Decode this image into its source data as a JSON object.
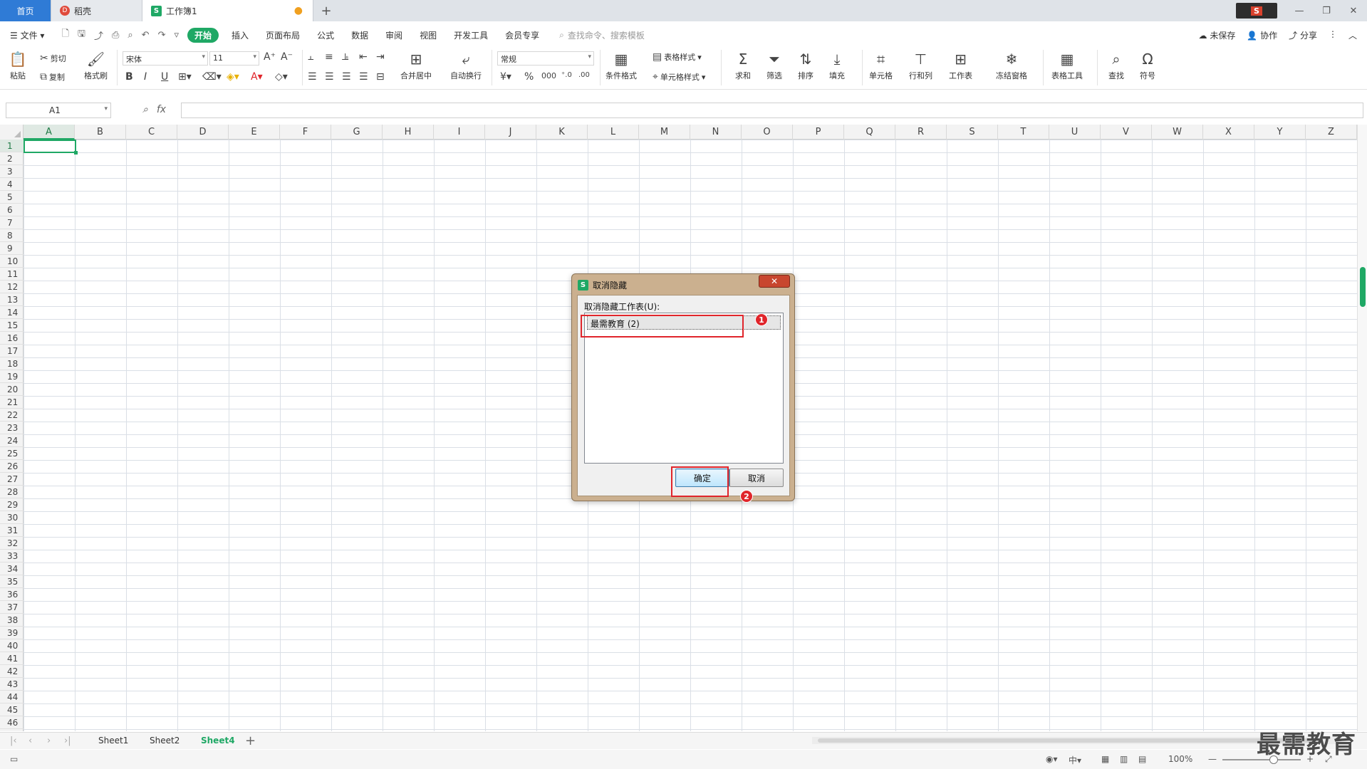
{
  "tabs": {
    "home": "首页",
    "docer": "稻壳",
    "workbook": "工作簿1",
    "add": "+"
  },
  "menu": {
    "file": "文件",
    "items": [
      "开始",
      "插入",
      "页面布局",
      "公式",
      "数据",
      "审阅",
      "视图",
      "开发工具",
      "会员专享"
    ],
    "search_placeholder": "查找命令、搜索模板",
    "unsaved": "未保存",
    "collab": "协作",
    "share": "分享"
  },
  "ribbon": {
    "paste": "粘贴",
    "cut": "剪切",
    "copy": "复制",
    "format_painter": "格式刷",
    "font_name": "宋体",
    "font_size": "11",
    "merge_center": "合并居中",
    "wrap_text": "自动换行",
    "number_format": "常规",
    "cond_format": "条件格式",
    "table_style": "表格样式",
    "cell_style": "单元格样式",
    "sum": "求和",
    "filter": "筛选",
    "sort": "排序",
    "fill": "填充",
    "cell": "单元格",
    "row_col": "行和列",
    "worksheet": "工作表",
    "freeze": "冻结窗格",
    "table_tools": "表格工具",
    "find": "查找",
    "symbol": "符号"
  },
  "formula_bar": {
    "cell_ref": "A1",
    "fx": "fx"
  },
  "columns": [
    "A",
    "B",
    "C",
    "D",
    "E",
    "F",
    "G",
    "H",
    "I",
    "J",
    "K",
    "L",
    "M",
    "N",
    "O",
    "P",
    "Q",
    "R",
    "S",
    "T",
    "U",
    "V",
    "W",
    "X",
    "Y",
    "Z"
  ],
  "rows": [
    "1",
    "2",
    "3",
    "4",
    "5",
    "6",
    "7",
    "8",
    "9",
    "10",
    "11",
    "12",
    "13",
    "14",
    "15",
    "16",
    "17",
    "18",
    "19",
    "20",
    "21",
    "22",
    "23",
    "24",
    "25",
    "26",
    "27",
    "28",
    "29",
    "30",
    "31",
    "32",
    "33",
    "34",
    "35",
    "36",
    "37",
    "38",
    "39",
    "40",
    "41",
    "42",
    "43",
    "44",
    "45",
    "46"
  ],
  "sheets": [
    "Sheet1",
    "Sheet2",
    "Sheet4"
  ],
  "active_sheet": "Sheet4",
  "status": {
    "zoom": "100%"
  },
  "dialog": {
    "title": "取消隐藏",
    "label": "取消隐藏工作表(U):",
    "items": [
      "最需教育 (2)"
    ],
    "ok": "确定",
    "cancel": "取消",
    "close": "✕",
    "badge1": "1",
    "badge2": "2"
  },
  "watermark": "最需教育",
  "colors": {
    "accent": "#1fa865",
    "home_tab": "#2f7bd6",
    "highlight": "#e0252b"
  }
}
